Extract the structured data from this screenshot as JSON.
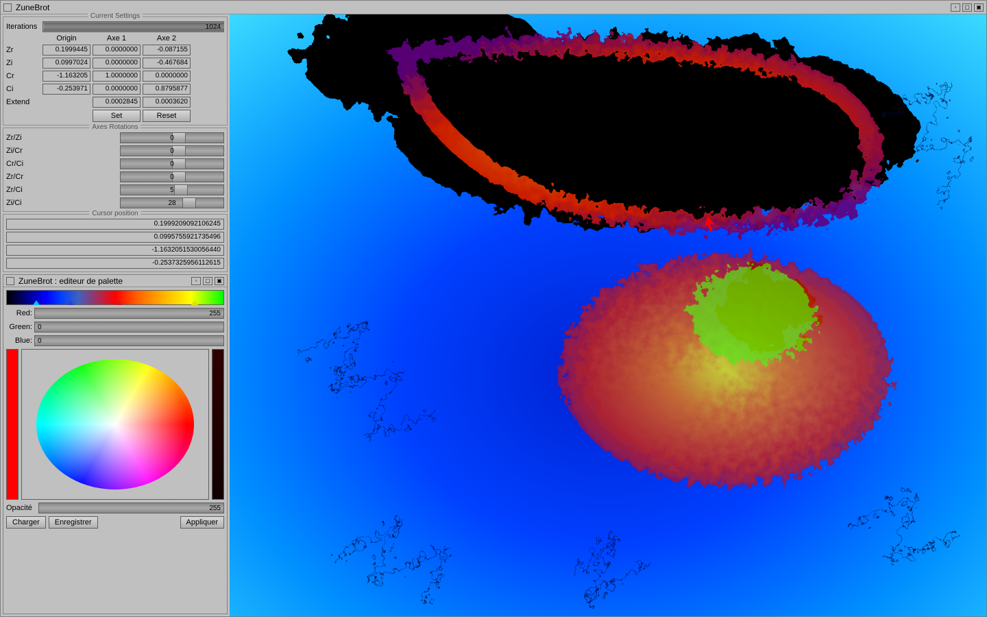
{
  "window": {
    "title": "ZuneBrot"
  },
  "settings": {
    "title": "Current Settings",
    "iterations_label": "Iterations",
    "iterations": "1024",
    "cols": [
      "Origin",
      "Axe 1",
      "Axe 2"
    ],
    "rows": [
      {
        "label": "Zr",
        "origin": "0.1999445",
        "axe1": "0.0000000",
        "axe2": "-0.087155"
      },
      {
        "label": "Zi",
        "origin": "0.0997024",
        "axe1": "0.0000000",
        "axe2": "-0.467684"
      },
      {
        "label": "Cr",
        "origin": "-1.163205",
        "axe1": "1.0000000",
        "axe2": "0.0000000"
      },
      {
        "label": "Ci",
        "origin": "-0.253971",
        "axe1": "0.0000000",
        "axe2": "0.8795877"
      }
    ],
    "extend_label": "Extend",
    "extend_axe1": "0.0002845",
    "extend_axe2": "0.0003620",
    "set_btn": "Set",
    "reset_btn": "Reset"
  },
  "rotations": {
    "title": "Axes Rotations",
    "items": [
      {
        "label": "Zr/Zi",
        "val": "0"
      },
      {
        "label": "Zi/Cr",
        "val": "0"
      },
      {
        "label": "Cr/Ci",
        "val": "0"
      },
      {
        "label": "Zr/Cr",
        "val": "0"
      },
      {
        "label": "Zr/Ci",
        "val": "5"
      },
      {
        "label": "Zi/Ci",
        "val": "28"
      }
    ]
  },
  "cursor": {
    "title": "Cursor position",
    "values": [
      "0.1999209092106245",
      "0.0995755921735496",
      "-1.1632051530056440",
      "-0.2537325956112615"
    ]
  },
  "palette": {
    "title": "ZuneBrot : editeur de palette",
    "red_label": "Red:",
    "red_val": "255",
    "green_label": "Green:",
    "green_val": "0",
    "blue_label": "Blue:",
    "blue_val": "0",
    "opacity_label": "Opacité",
    "opacity_val": "255",
    "load_btn": "Charger",
    "save_btn": "Enregistrer",
    "apply_btn": "Appliquer"
  }
}
